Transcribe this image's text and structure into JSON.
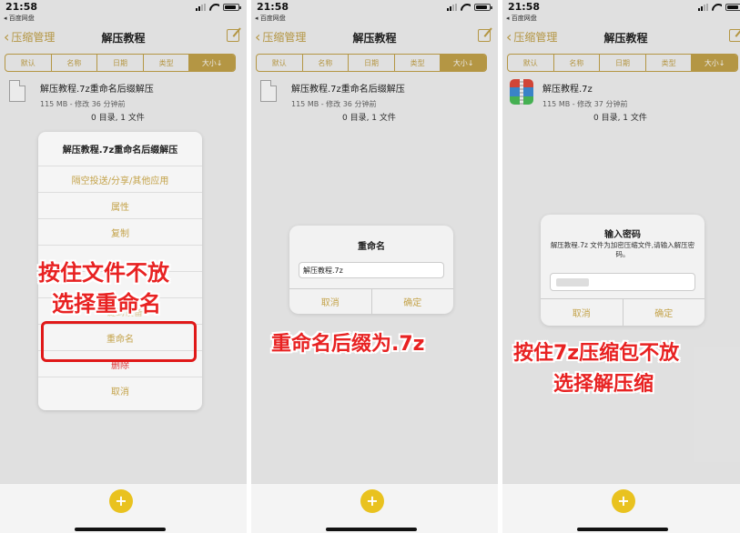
{
  "status": {
    "time": "21:58",
    "back_app": "◂ 百度网盘"
  },
  "nav": {
    "back_label": "压缩管理",
    "title": "解压教程"
  },
  "sort_tabs": [
    "默认",
    "名称",
    "日期",
    "类型",
    "大小↓"
  ],
  "panels": [
    {
      "file": {
        "name": "解压教程.7z重命名后缀解压",
        "meta": "115 MB - 修改 36 分钟前",
        "count": "0 目录, 1 文件"
      },
      "sheet": {
        "title": "解压教程.7z重命名后缀解压",
        "items": [
          "隔空投送/分享/其他应用",
          "属性",
          "复制",
          "",
          "一键到设备",
          "重命名",
          "删除",
          "取消"
        ]
      },
      "caption": {
        "line1": "按住文件不放",
        "line2": "选择重命名"
      }
    },
    {
      "file": {
        "name": "解压教程.7z重命名后缀解压",
        "meta": "115 MB - 修改 36 分钟前",
        "count": "0 目录, 1 文件"
      },
      "dialog": {
        "title": "重命名",
        "input_value": "解压教程.7z",
        "cancel": "取消",
        "ok": "确定"
      },
      "caption": {
        "line1": "重命名后缀为.7z"
      }
    },
    {
      "file": {
        "name": "解压教程.7z",
        "meta": "115 MB - 修改 37 分钟前",
        "count": "0 目录, 1 文件"
      },
      "dialog": {
        "title": "输入密码",
        "message": "解压教程.7z 文件为加密压缩文件,请输入解压密码。",
        "cancel": "取消",
        "ok": "确定"
      },
      "caption": {
        "line1": "按住7z压缩包不放",
        "line2": "选择解压缩"
      }
    }
  ],
  "add_button": "+",
  "colors": {
    "accent": "#c4a34a",
    "caption": "#e82222",
    "add": "#e9c21f"
  }
}
